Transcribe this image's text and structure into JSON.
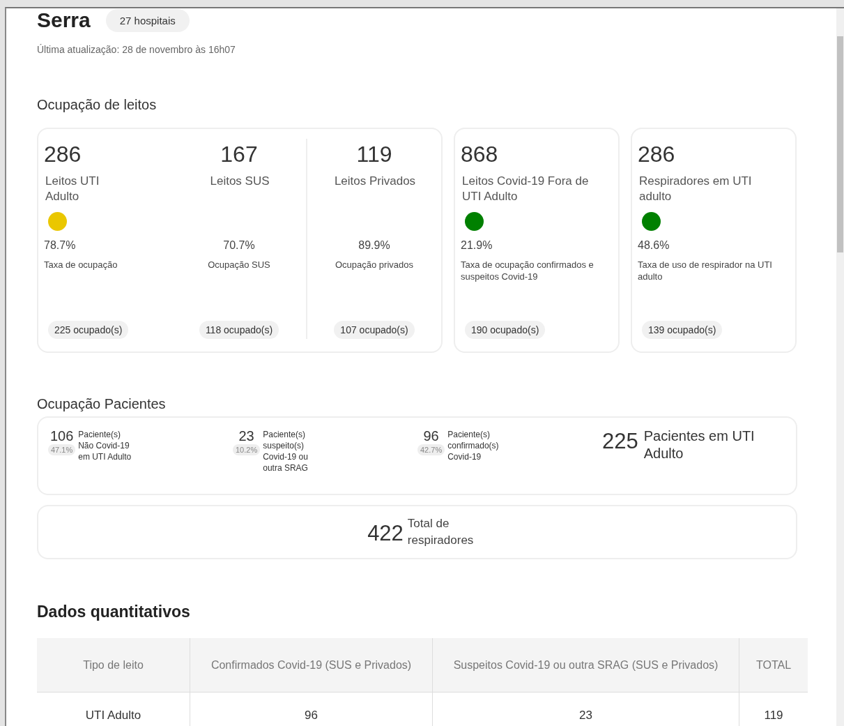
{
  "header": {
    "title": "Serra",
    "badge": "27 hospitais",
    "updated": "Última atualização: 28 de novembro às 16h07"
  },
  "beds": {
    "title": "Ocupação de leitos",
    "groups": [
      {
        "items": [
          {
            "value": "286",
            "label": "Leitos UTI Adulto",
            "color": "#eac700",
            "percent": "78.7%",
            "rate_label": "Taxa de ocupação",
            "occupied": "225 ocupado(s)"
          },
          {
            "value": "167",
            "label": "Leitos SUS",
            "percent": "70.7%",
            "rate_label": "Ocupação SUS",
            "occupied": "118 ocupado(s)"
          },
          {
            "value": "119",
            "label": "Leitos Privados",
            "percent": "89.9%",
            "rate_label": "Ocupação privados",
            "occupied": "107 ocupado(s)"
          }
        ]
      },
      {
        "items": [
          {
            "value": "868",
            "label": "Leitos Covid-19 Fora de UTI Adulto",
            "color": "#008000",
            "percent": "21.9%",
            "rate_label": "Taxa de ocupação confirmados e suspeitos Covid-19",
            "occupied": "190 ocupado(s)"
          }
        ]
      },
      {
        "items": [
          {
            "value": "286",
            "label": "Respiradores em UTI adulto",
            "color": "#008000",
            "percent": "48.6%",
            "rate_label": "Taxa de uso de respirador na UTI adulto",
            "occupied": "139 ocupado(s)"
          }
        ]
      }
    ]
  },
  "patients": {
    "title": "Ocupação Pacientes",
    "items": [
      {
        "value": "106",
        "percent": "47.1%",
        "label": "Paciente(s) Não Covid-19 em UTI Adulto"
      },
      {
        "value": "23",
        "percent": "10.2%",
        "label": "Paciente(s) suspeito(s) Covid-19 ou outra SRAG"
      },
      {
        "value": "96",
        "percent": "42.7%",
        "label": "Paciente(s) confirmado(s) Covid-19"
      }
    ],
    "total": {
      "value": "225",
      "label": "Pacientes em UTI Adulto"
    }
  },
  "respirators": {
    "value": "422",
    "label": "Total de respiradores"
  },
  "quantitative": {
    "title": "Dados quantitativos",
    "columns": [
      "Tipo de leito",
      "Confirmados Covid-19 (SUS e Privados)",
      "Suspeitos Covid-19 ou outra SRAG (SUS e Privados)",
      "TOTAL"
    ],
    "rows": [
      [
        "UTI Adulto",
        "96",
        "23",
        "119"
      ]
    ]
  }
}
